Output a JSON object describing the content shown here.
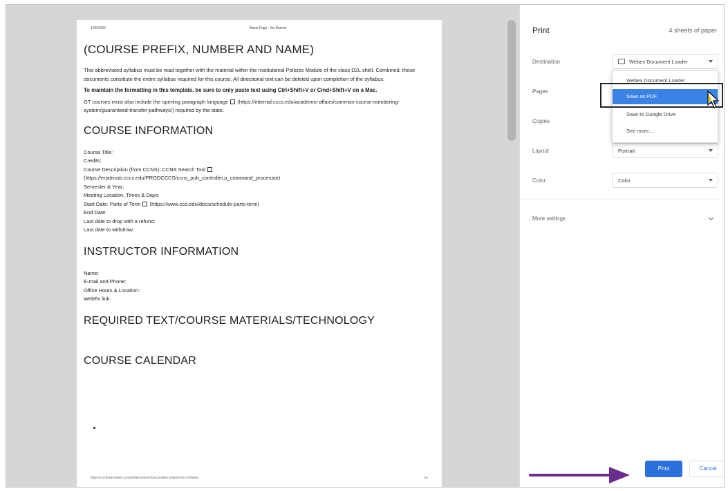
{
  "preview": {
    "header_date": "1/26/2021",
    "header_title": "Basic Page - No Banner",
    "course_heading": "(COURSE PREFIX, NUMBER AND NAME)",
    "intro_text": "This abbreviated syllabus must be read together with the material within the Institutional Policies Module of the class D2L shell. Combined, these documents constitute the entire syllabus required for this course. All directional text can be deleted upon completion of the syllabus.",
    "formatting_note": "To maintain the formatting in this template, be sure to only paste text using Ctrl+Shift+V or Cmd+Shift+V on a Mac.",
    "gt_text_a": "GT courses must also include the opening paragraph language",
    "gt_text_b": "(https://internal.cccs.edu/academic-affairs/common-course-numbering-system/guaranteed-transfer-pathways/) required by the state.",
    "course_info_heading": "COURSE INFORMATION",
    "course_title": "Course Title:",
    "credits": "Credits:",
    "course_desc_a": "Course Description (from CCNS): CCNS Search Tool",
    "course_desc_b": "(https://erpdnssb.cccs.edu/PRODCCCS/ccns_pub_controller.p_command_processor)",
    "semester": "Semester & Year:",
    "meeting": "Meeting Location, Times & Days:",
    "start_date_a": "Start Date: Parts of Term",
    "start_date_b": "(https://www.ccd.edu/docs/schedule-parts-term)",
    "end_date": "End Date:",
    "last_refund": "Last date to drop with a refund:",
    "last_withdraw": "Last date to withdraw:",
    "instructor_heading": "INSTRUCTOR INFORMATION",
    "name": "Name:",
    "email": "E-mail and Phone:",
    "office": "Office Hours & Location:",
    "webex": "WebEx link:",
    "materials_heading": "REQUIRED TEXT/COURSE MATERIALS/TECHNOLOGY",
    "calendar_heading": "COURSE CALENDAR",
    "footer_url": "https://ccd.desire2learn.com/d2l/le/content/204112/viewContent/4102724/View",
    "footer_page": "1/4"
  },
  "sidebar": {
    "title": "Print",
    "sheets": "4 sheets of paper",
    "destination_label": "Destination",
    "destination_value": "Webex Document Loader",
    "pages_label": "Pages",
    "copies_label": "Copies",
    "layout_label": "Layout",
    "layout_value": "Portrait",
    "color_label": "Color",
    "color_value": "Color",
    "more_settings": "More settings",
    "dropdown": [
      "Webex Document Loader",
      "Save as PDF",
      "Save to Google Drive",
      "See more..."
    ],
    "print_button": "Print",
    "cancel_button": "Cancel"
  },
  "colors": {
    "accent": "#2a6fdb",
    "dropdown_selected": "#3b82e5",
    "arrow": "#6b2c91"
  }
}
